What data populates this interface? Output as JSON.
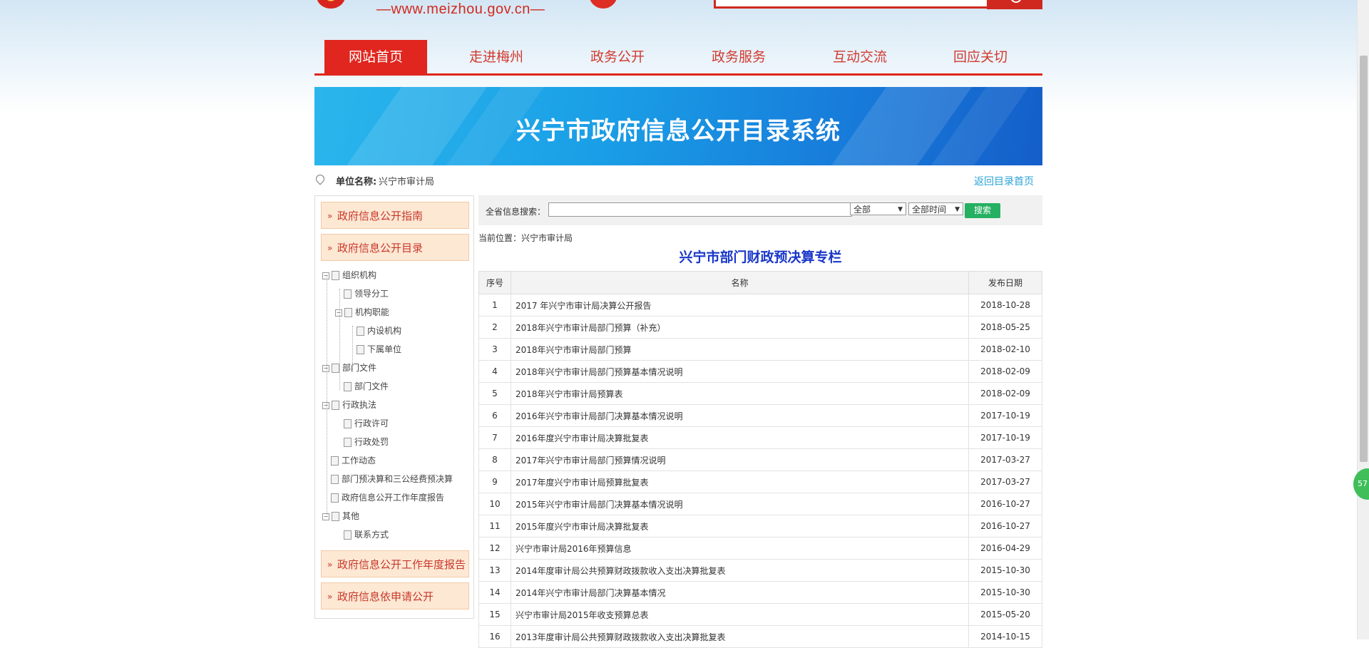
{
  "header": {
    "site_url": "—www.meizhou.gov.cn—"
  },
  "nav": {
    "items": [
      {
        "label": "网站首页",
        "active": true
      },
      {
        "label": "走进梅州"
      },
      {
        "label": "政务公开"
      },
      {
        "label": "政务服务"
      },
      {
        "label": "互动交流"
      },
      {
        "label": "回应关切"
      }
    ]
  },
  "banner": {
    "title": "兴宁市政府信息公开目录系统"
  },
  "unit": {
    "label": "单位名称:",
    "value": "兴宁市审计局",
    "back_link": "返回目录首页"
  },
  "sidebar": {
    "heads": [
      "政府信息公开指南",
      "政府信息公开目录",
      "政府信息公开工作年度报告",
      "政府信息依申请公开"
    ],
    "tree": [
      {
        "label": "组织机构",
        "level": 0,
        "type": "folder"
      },
      {
        "label": "领导分工",
        "level": 1,
        "type": "doc"
      },
      {
        "label": "机构职能",
        "level": 1,
        "type": "folder"
      },
      {
        "label": "内设机构",
        "level": 2,
        "type": "doc"
      },
      {
        "label": "下属单位",
        "level": 2,
        "type": "doc"
      },
      {
        "label": "部门文件",
        "level": 0,
        "type": "folder"
      },
      {
        "label": "部门文件",
        "level": 1,
        "type": "doc"
      },
      {
        "label": "行政执法",
        "level": 0,
        "type": "folder"
      },
      {
        "label": "行政许可",
        "level": 1,
        "type": "doc"
      },
      {
        "label": "行政处罚",
        "level": 1,
        "type": "doc"
      },
      {
        "label": "工作动态",
        "level": 0,
        "type": "doc"
      },
      {
        "label": "部门预决算和三公经费预决算",
        "level": 0,
        "type": "doc"
      },
      {
        "label": "政府信息公开工作年度报告",
        "level": 0,
        "type": "doc"
      },
      {
        "label": "其他",
        "level": 0,
        "type": "folder"
      },
      {
        "label": "联系方式",
        "level": 1,
        "type": "doc"
      }
    ]
  },
  "search": {
    "label": "全省信息搜索：",
    "input_value": "",
    "scope": "全部",
    "time": "全部时间",
    "button": "搜索"
  },
  "crumb": "当前位置：兴宁市审计局",
  "section_title": "兴宁市部门财政预决算专栏",
  "table": {
    "headers": [
      "序号",
      "名称",
      "发布日期"
    ],
    "rows": [
      [
        "1",
        "2017 年兴宁市审计局决算公开报告",
        "2018-10-28"
      ],
      [
        "2",
        "2018年兴宁市审计局部门预算（补充）",
        "2018-05-25"
      ],
      [
        "3",
        "2018年兴宁市审计局部门预算",
        "2018-02-10"
      ],
      [
        "4",
        "2018年兴宁市审计局部门预算基本情况说明",
        "2018-02-09"
      ],
      [
        "5",
        "2018年兴宁市审计局预算表",
        "2018-02-09"
      ],
      [
        "6",
        "2016年兴宁市审计局部门决算基本情况说明",
        "2017-10-19"
      ],
      [
        "7",
        "2016年度兴宁市审计局决算批复表",
        "2017-10-19"
      ],
      [
        "8",
        "2017年兴宁市审计局部门预算情况说明",
        "2017-03-27"
      ],
      [
        "9",
        "2017年度兴宁市审计局预算批复表",
        "2017-03-27"
      ],
      [
        "10",
        "2015年兴宁市审计局部门决算基本情况说明",
        "2016-10-27"
      ],
      [
        "11",
        "2015年度兴宁市审计局决算批复表",
        "2016-10-27"
      ],
      [
        "12",
        "兴宁市审计局2016年预算信息",
        "2016-04-29"
      ],
      [
        "13",
        "2014年度审计局公共预算财政拨款收入支出决算批复表",
        "2015-10-30"
      ],
      [
        "14",
        "2014年兴宁市审计局部门决算基本情况",
        "2015-10-30"
      ],
      [
        "15",
        "兴宁市审计局2015年收支预算总表",
        "2015-05-20"
      ],
      [
        "16",
        "2013年度审计局公共预算财政拨款收入支出决算批复表",
        "2014-10-15"
      ]
    ]
  },
  "float_badge": "57",
  "colors": {
    "brand_red": "#e0261e",
    "banner_blue": "#1a9ee6",
    "title_blue": "#1836c9",
    "search_green": "#25b062",
    "side_bg": "#fde8d4"
  }
}
